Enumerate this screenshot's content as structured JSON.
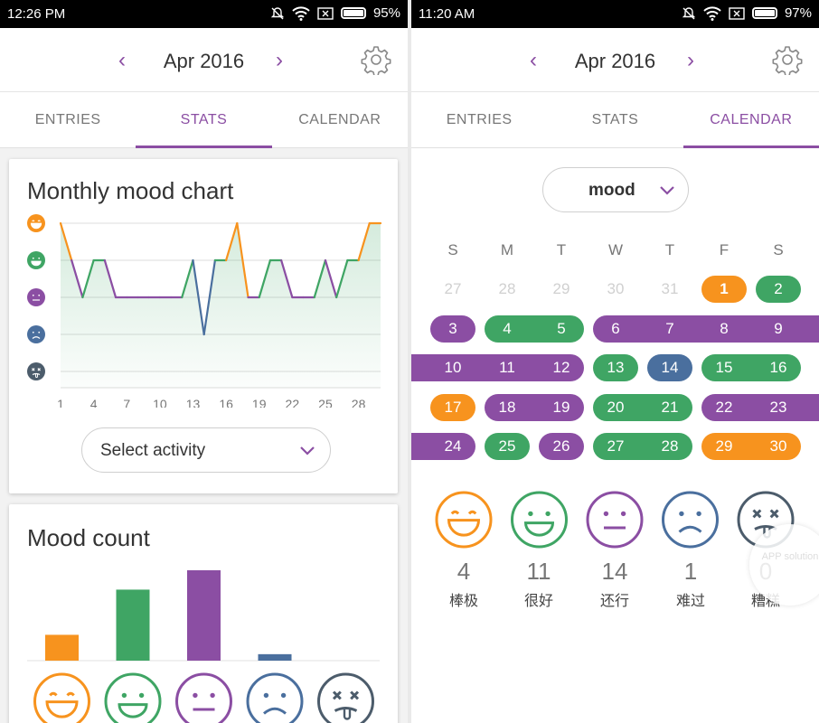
{
  "left": {
    "status": {
      "time": "12:26 PM",
      "battery": "95%"
    },
    "header": {
      "month": "Apr 2016",
      "prev": "‹",
      "next": "›"
    },
    "tabs": [
      "ENTRIES",
      "STATS",
      "CALENDAR"
    ],
    "active_tab": "STATS",
    "mood_chart": {
      "title": "Monthly mood chart",
      "select_label": "Select activity"
    },
    "mood_count": {
      "title": "Mood count"
    }
  },
  "right": {
    "status": {
      "time": "11:20 AM",
      "battery": "97%"
    },
    "header": {
      "month": "Apr 2016",
      "prev": "‹",
      "next": "›"
    },
    "tabs": [
      "ENTRIES",
      "STATS",
      "CALENDAR"
    ],
    "active_tab": "CALENDAR",
    "mood_select": "mood",
    "weekdays": [
      "S",
      "M",
      "T",
      "W",
      "T",
      "F",
      "S"
    ],
    "counts": [
      {
        "value": "4",
        "label": "棒极"
      },
      {
        "value": "11",
        "label": "很好"
      },
      {
        "value": "14",
        "label": "还行"
      },
      {
        "value": "1",
        "label": "难过"
      },
      {
        "value": "0",
        "label": "糟糕"
      }
    ],
    "watermark": "APP solution"
  },
  "colors": {
    "rad": "#f7931e",
    "good": "#3fa564",
    "meh": "#8b4ea3",
    "sad": "#4a6f9e",
    "awful": "#4c5c6b",
    "accent": "#8b4ea3"
  },
  "chart_data": [
    {
      "type": "line",
      "title": "Monthly mood chart",
      "x_ticks": [
        1,
        4,
        7,
        10,
        13,
        16,
        19,
        22,
        25,
        28
      ],
      "y_categories": [
        "awful",
        "sad",
        "meh",
        "good",
        "rad"
      ],
      "x": [
        1,
        2,
        3,
        4,
        5,
        6,
        7,
        8,
        9,
        10,
        11,
        12,
        13,
        14,
        15,
        16,
        17,
        18,
        19,
        20,
        21,
        22,
        23,
        24,
        25,
        26,
        27,
        28,
        29,
        30
      ],
      "y": [
        5,
        4,
        3,
        4,
        4,
        3,
        3,
        3,
        3,
        3,
        3,
        3,
        4,
        2,
        4,
        4,
        5,
        3,
        3,
        4,
        4,
        3,
        3,
        3,
        4,
        3,
        4,
        4,
        5,
        5
      ],
      "xlim": [
        1,
        30
      ],
      "ylim": [
        1,
        5
      ],
      "grid": true
    },
    {
      "type": "bar",
      "title": "Mood count",
      "categories": [
        "rad",
        "good",
        "meh",
        "sad",
        "awful"
      ],
      "values": [
        4,
        11,
        14,
        1,
        0
      ],
      "ylim": [
        0,
        14
      ]
    }
  ],
  "calendar": {
    "prev_month_days": [
      27,
      28,
      29,
      30,
      31
    ],
    "days": [
      {
        "d": 1,
        "m": "rad"
      },
      {
        "d": 2,
        "m": "good"
      },
      {
        "d": 3,
        "m": "meh"
      },
      {
        "d": 4,
        "m": "good"
      },
      {
        "d": 5,
        "m": "good"
      },
      {
        "d": 6,
        "m": "meh"
      },
      {
        "d": 7,
        "m": "meh"
      },
      {
        "d": 8,
        "m": "meh"
      },
      {
        "d": 9,
        "m": "meh"
      },
      {
        "d": 10,
        "m": "meh"
      },
      {
        "d": 11,
        "m": "meh"
      },
      {
        "d": 12,
        "m": "meh"
      },
      {
        "d": 13,
        "m": "good"
      },
      {
        "d": 14,
        "m": "sad"
      },
      {
        "d": 15,
        "m": "good"
      },
      {
        "d": 16,
        "m": "good"
      },
      {
        "d": 17,
        "m": "rad"
      },
      {
        "d": 18,
        "m": "meh"
      },
      {
        "d": 19,
        "m": "meh"
      },
      {
        "d": 20,
        "m": "good"
      },
      {
        "d": 21,
        "m": "good"
      },
      {
        "d": 22,
        "m": "meh"
      },
      {
        "d": 23,
        "m": "meh"
      },
      {
        "d": 24,
        "m": "meh"
      },
      {
        "d": 25,
        "m": "good"
      },
      {
        "d": 26,
        "m": "meh"
      },
      {
        "d": 27,
        "m": "good"
      },
      {
        "d": 28,
        "m": "good"
      },
      {
        "d": 29,
        "m": "rad"
      },
      {
        "d": 30,
        "m": "rad"
      }
    ],
    "today": 1
  }
}
